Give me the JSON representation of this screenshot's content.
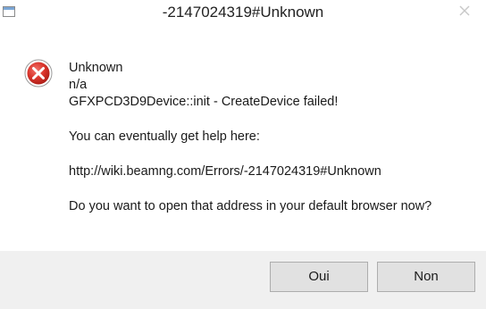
{
  "window": {
    "title": "-2147024319#Unknown"
  },
  "message": {
    "line1": "Unknown",
    "line2": "n/a",
    "line3": "GFXPCD3D9Device::init - CreateDevice failed!",
    "line4": "You can eventually get help here:",
    "line5": "http://wiki.beamng.com/Errors/-2147024319#Unknown",
    "line6": "Do you want to open that address in your default browser now?"
  },
  "buttons": {
    "yes_label": "Oui",
    "no_label": "Non"
  },
  "icons": {
    "error": "error-icon",
    "close": "close-icon",
    "app": "app-icon"
  },
  "colors": {
    "error_red": "#d9342b",
    "close_glyph": "#c8c8c8"
  }
}
